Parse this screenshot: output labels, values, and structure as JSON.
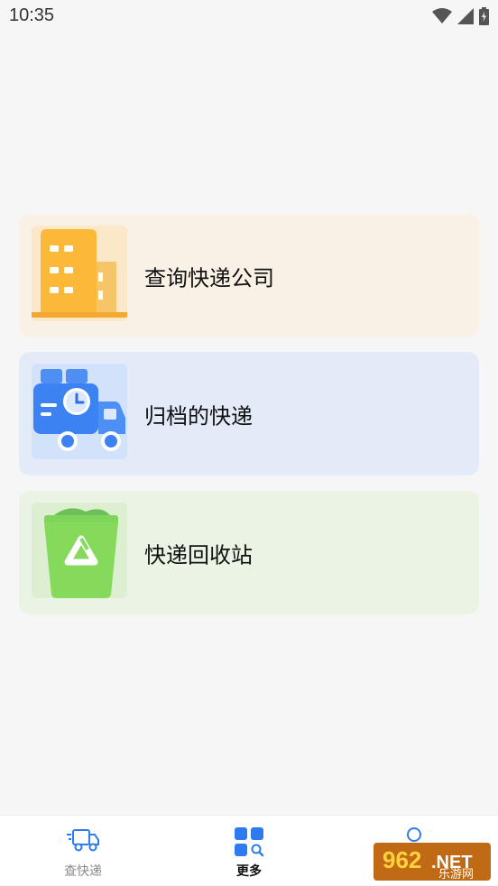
{
  "status": {
    "time": "10:35"
  },
  "cards": [
    {
      "label": "查询快递公司",
      "bg": "#faf1e6",
      "icon": "building-icon"
    },
    {
      "label": "归档的快递",
      "bg": "#e3ebf9",
      "icon": "delivery-truck-icon"
    },
    {
      "label": "快递回收站",
      "bg": "#ebf4e4",
      "icon": "recycle-bin-icon"
    }
  ],
  "tabs": [
    {
      "label": "查快递",
      "active": false
    },
    {
      "label": "更多",
      "active": true
    }
  ],
  "watermark": {
    "text": "962.NET",
    "sub": "乐游网"
  },
  "colors": {
    "accent": "#2e7bf0",
    "inactive": "#8a8a8a"
  }
}
